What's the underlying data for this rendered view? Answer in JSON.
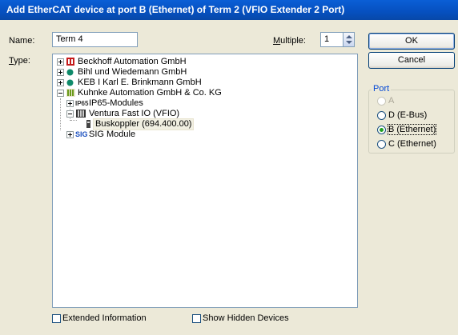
{
  "window": {
    "title": "Add EtherCAT device at port B (Ethernet) of Term 2 (VFIO Extender 2 Port)"
  },
  "name_field": {
    "label": "Name:",
    "value": "Term 4"
  },
  "multiple": {
    "label": "Multiple:",
    "value": "1"
  },
  "type_label": "Type:",
  "buttons": {
    "ok": "OK",
    "cancel": "Cancel"
  },
  "tree": {
    "beckhoff": "Beckhoff Automation GmbH",
    "bihl": "Bihl und Wiedemann GmbH",
    "keb": "KEB I Karl E. Brinkmann GmbH",
    "kuhnke": "Kuhnke Automation GmbH & Co. KG",
    "ip65_badge": "IP65",
    "ip65": "IP65-Modules",
    "ventura": "Ventura Fast IO (VFIO)",
    "buskoppler": "Buskoppler (694.400.00)",
    "sig_badge": "SIG",
    "sig": "SIG Module"
  },
  "port": {
    "title": "Port",
    "options": [
      "A",
      "D (E-Bus)",
      "B (Ethernet)",
      "C (Ethernet)"
    ],
    "selected": "B (Ethernet)"
  },
  "checkboxes": {
    "extended": "Extended Information",
    "hidden": "Show Hidden Devices"
  }
}
